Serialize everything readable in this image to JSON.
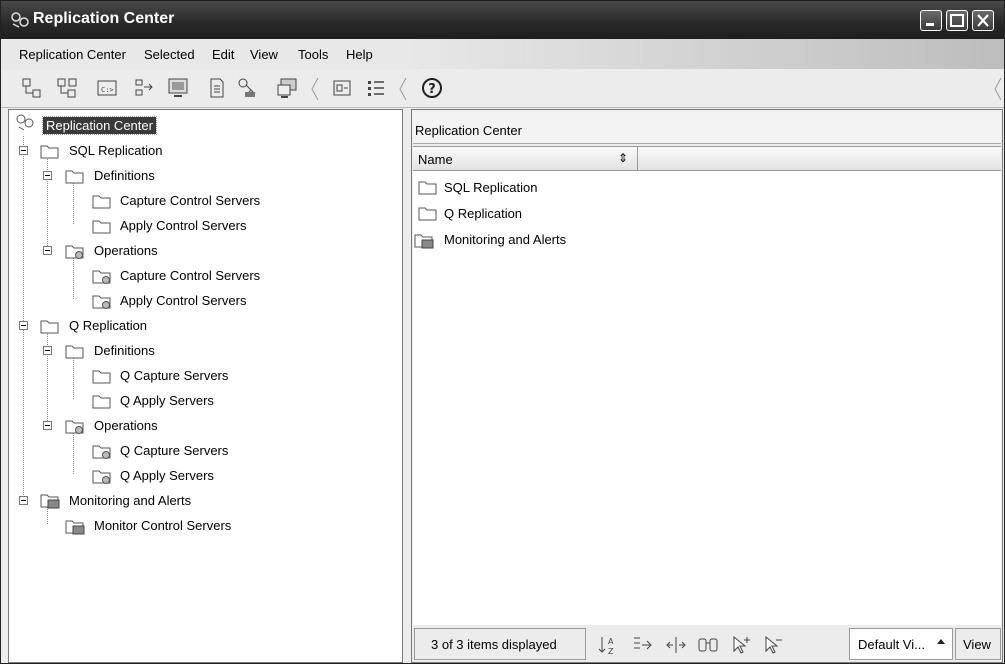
{
  "window": {
    "title": "Replication Center"
  },
  "menu": [
    "Replication Center",
    "Selected",
    "Edit",
    "View",
    "Tools",
    "Help"
  ],
  "toolbar": {
    "icons": [
      "tree-icon",
      "tree-alt-icon",
      "command-icon",
      "connect-icon",
      "monitor-icon",
      "document-icon",
      "key-icon",
      "computer-icon",
      "filter-icon",
      "details-icon",
      "help-icon"
    ],
    "help_label": "?"
  },
  "tree": {
    "root": "Replication Center",
    "nodes": [
      "SQL Replication",
      "Definitions",
      "Capture Control Servers",
      "Apply Control Servers",
      "Operations",
      "Capture Control Servers",
      "Apply Control Servers",
      "Q Replication",
      "Definitions",
      "Q Capture Servers",
      "Q Apply Servers",
      "Operations",
      "Q Capture Servers",
      "Q Apply Servers",
      "Monitoring and Alerts",
      "Monitor Control Servers"
    ]
  },
  "details": {
    "title": "Replication Center",
    "column": "Name",
    "sort_glyph": "⇕",
    "items": [
      "SQL Replication",
      "Q Replication",
      "Monitoring and Alerts"
    ],
    "status": "3 of 3 items displayed",
    "view_select": "Default Vi...",
    "view_button": "View"
  }
}
